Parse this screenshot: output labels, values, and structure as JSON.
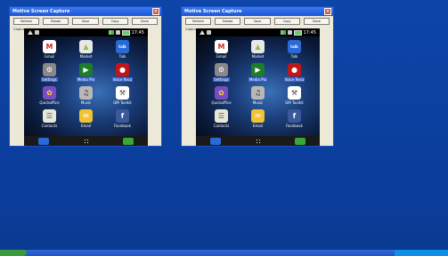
{
  "windows": [
    {
      "title": "Motive Screen Capture",
      "buttons": [
        "Refresh",
        "Rotate",
        "Save",
        "Copy",
        "Done"
      ],
      "captured_label": "Captured image:",
      "phone": {
        "clock": "17:45",
        "apps": [
          {
            "label": "Gmail",
            "icon": "gmail-icon",
            "color": "#ffffff",
            "glyph": "M",
            "glyph_color": "#d02a1e"
          },
          {
            "label": "Market",
            "icon": "market-icon",
            "color": "#e8e8e8",
            "glyph": "▲",
            "glyph_color": "#8bc34a"
          },
          {
            "label": "Talk",
            "icon": "talk-icon",
            "color": "#2a6ad8",
            "glyph": "talk",
            "glyph_color": "#ffffff"
          },
          {
            "label": "Settings",
            "icon": "settings-icon",
            "color": "#888888",
            "glyph": "⚙",
            "glyph_color": "#ffffff"
          },
          {
            "label": "Media Pla",
            "icon": "media-player-icon",
            "color": "#1e7d2a",
            "glyph": "▶",
            "glyph_color": "#ffffff"
          },
          {
            "label": "Voice Reco",
            "icon": "voice-recorder-icon",
            "color": "#c01818",
            "glyph": "●",
            "glyph_color": "#ffffff"
          },
          {
            "label": "Quickoffice",
            "icon": "quickoffice-icon",
            "color": "#7a4cc4",
            "glyph": "✿",
            "glyph_color": "#ffd23a"
          },
          {
            "label": "Music",
            "icon": "music-icon",
            "color": "#b8b8b8",
            "glyph": "♫",
            "glyph_color": "#222222"
          },
          {
            "label": "GM Toolkit",
            "icon": "gm-toolkit-icon",
            "color": "#ffffff",
            "glyph": "⚒",
            "glyph_color": "#444444"
          },
          {
            "label": "Contacts",
            "icon": "contacts-icon",
            "color": "#e8e8d8",
            "glyph": "☰",
            "glyph_color": "#555555"
          },
          {
            "label": "Email",
            "icon": "email-icon",
            "color": "#f2c230",
            "glyph": "✉",
            "glyph_color": "#ffffff"
          },
          {
            "label": "Facebook",
            "icon": "facebook-icon",
            "color": "#3b5998",
            "glyph": "f",
            "glyph_color": "#ffffff"
          }
        ]
      }
    },
    {
      "title": "Motive Screen Capture",
      "buttons": [
        "Refresh",
        "Rotate",
        "Save",
        "Copy",
        "Done"
      ],
      "captured_label": "Captured image:",
      "phone": {
        "clock": "17:45",
        "apps": [
          {
            "label": "Gmail",
            "icon": "gmail-icon",
            "color": "#ffffff",
            "glyph": "M",
            "glyph_color": "#d02a1e"
          },
          {
            "label": "Market",
            "icon": "market-icon",
            "color": "#e8e8e8",
            "glyph": "▲",
            "glyph_color": "#8bc34a"
          },
          {
            "label": "Talk",
            "icon": "talk-icon",
            "color": "#2a6ad8",
            "glyph": "talk",
            "glyph_color": "#ffffff"
          },
          {
            "label": "Settings",
            "icon": "settings-icon",
            "color": "#888888",
            "glyph": "⚙",
            "glyph_color": "#ffffff"
          },
          {
            "label": "Media Pla",
            "icon": "media-player-icon",
            "color": "#1e7d2a",
            "glyph": "▶",
            "glyph_color": "#ffffff"
          },
          {
            "label": "Voice Reco",
            "icon": "voice-recorder-icon",
            "color": "#c01818",
            "glyph": "●",
            "glyph_color": "#ffffff"
          },
          {
            "label": "Quickoffice",
            "icon": "quickoffice-icon",
            "color": "#7a4cc4",
            "glyph": "✿",
            "glyph_color": "#ffd23a"
          },
          {
            "label": "Music",
            "icon": "music-icon",
            "color": "#b8b8b8",
            "glyph": "♫",
            "glyph_color": "#222222"
          },
          {
            "label": "GM Toolkit",
            "icon": "gm-toolkit-icon",
            "color": "#ffffff",
            "glyph": "⚒",
            "glyph_color": "#444444"
          },
          {
            "label": "Contacts",
            "icon": "contacts-icon",
            "color": "#e8e8d8",
            "glyph": "☰",
            "glyph_color": "#555555"
          },
          {
            "label": "Email",
            "icon": "email-icon",
            "color": "#f2c230",
            "glyph": "✉",
            "glyph_color": "#ffffff"
          },
          {
            "label": "Facebook",
            "icon": "facebook-icon",
            "color": "#3b5998",
            "glyph": "f",
            "glyph_color": "#ffffff"
          }
        ]
      }
    }
  ],
  "colors": {
    "desktop": "#0a3fa0",
    "taskbar": "#1e54c8",
    "titlebar": "#1d56d8"
  }
}
